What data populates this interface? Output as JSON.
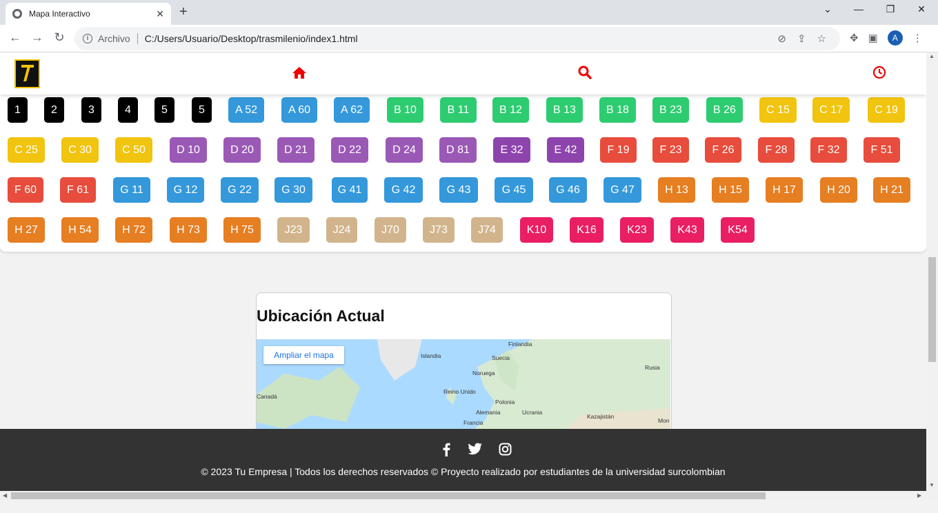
{
  "browser": {
    "tab_title": "Mapa Interactivo",
    "new_tab": "+",
    "close_tab": "✕",
    "address_prefix": "Archivo",
    "url": "C:/Users/Usuario/Desktop/trasmilenio/index1.html",
    "profile_initial": "A"
  },
  "header": {
    "home_icon": "home-icon",
    "search_icon": "search-icon",
    "history_icon": "clock-icon",
    "accent_color": "#e00000"
  },
  "colors": {
    "black": "#000000",
    "blue": "#3498db",
    "green": "#2ecc71",
    "yellow": "#f1c40f",
    "purple": "#9b59b6",
    "dark_purple": "#8e44ad",
    "red": "#e74c3c",
    "orange": "#e67e22",
    "tan": "#d2b48c",
    "pink": "#e91e63"
  },
  "routes": [
    {
      "label": "1",
      "color": "black"
    },
    {
      "label": "2",
      "color": "black"
    },
    {
      "label": "3",
      "color": "black"
    },
    {
      "label": "4",
      "color": "black"
    },
    {
      "label": "5",
      "color": "black"
    },
    {
      "label": "5",
      "color": "black"
    },
    {
      "label": "A 52",
      "color": "blue"
    },
    {
      "label": "A 60",
      "color": "blue"
    },
    {
      "label": "A 62",
      "color": "blue"
    },
    {
      "label": "B 10",
      "color": "green"
    },
    {
      "label": "B 11",
      "color": "green"
    },
    {
      "label": "B 12",
      "color": "green"
    },
    {
      "label": "B 13",
      "color": "green"
    },
    {
      "label": "B 18",
      "color": "green"
    },
    {
      "label": "B 23",
      "color": "green"
    },
    {
      "label": "B 26",
      "color": "green"
    },
    {
      "label": "C 15",
      "color": "yellow"
    },
    {
      "label": "C 17",
      "color": "yellow"
    },
    {
      "label": "C 19",
      "color": "yellow"
    },
    {
      "label": "C 25",
      "color": "yellow"
    },
    {
      "label": "C 30",
      "color": "yellow"
    },
    {
      "label": "C 50",
      "color": "yellow"
    },
    {
      "label": "D 10",
      "color": "purple"
    },
    {
      "label": "D 20",
      "color": "purple"
    },
    {
      "label": "D 21",
      "color": "purple"
    },
    {
      "label": "D 22",
      "color": "purple"
    },
    {
      "label": "D 24",
      "color": "purple"
    },
    {
      "label": "D 81",
      "color": "purple"
    },
    {
      "label": "E 32",
      "color": "dark_purple"
    },
    {
      "label": "E 42",
      "color": "dark_purple"
    },
    {
      "label": "F 19",
      "color": "red"
    },
    {
      "label": "F 23",
      "color": "red"
    },
    {
      "label": "F 26",
      "color": "red"
    },
    {
      "label": "F 28",
      "color": "red"
    },
    {
      "label": "F 32",
      "color": "red"
    },
    {
      "label": "F 51",
      "color": "red"
    },
    {
      "label": "F 60",
      "color": "red"
    },
    {
      "label": "F 61",
      "color": "red"
    },
    {
      "label": "G 11",
      "color": "blue"
    },
    {
      "label": "G 12",
      "color": "blue"
    },
    {
      "label": "G 22",
      "color": "blue"
    },
    {
      "label": "G 30",
      "color": "blue"
    },
    {
      "label": "G 41",
      "color": "blue"
    },
    {
      "label": "G 42",
      "color": "blue"
    },
    {
      "label": "G 43",
      "color": "blue"
    },
    {
      "label": "G 45",
      "color": "blue"
    },
    {
      "label": "G 46",
      "color": "blue"
    },
    {
      "label": "G 47",
      "color": "blue"
    },
    {
      "label": "H 13",
      "color": "orange"
    },
    {
      "label": "H 15",
      "color": "orange"
    },
    {
      "label": "H 17",
      "color": "orange"
    },
    {
      "label": "H 20",
      "color": "orange"
    },
    {
      "label": "H 21",
      "color": "orange"
    },
    {
      "label": "H 27",
      "color": "orange"
    },
    {
      "label": "H 54",
      "color": "orange"
    },
    {
      "label": "H 72",
      "color": "orange"
    },
    {
      "label": "H 73",
      "color": "orange"
    },
    {
      "label": "H 75",
      "color": "orange"
    },
    {
      "label": "J23",
      "color": "tan"
    },
    {
      "label": "J24",
      "color": "tan"
    },
    {
      "label": "J70",
      "color": "tan"
    },
    {
      "label": "J73",
      "color": "tan"
    },
    {
      "label": "J74",
      "color": "tan"
    },
    {
      "label": "K10",
      "color": "pink"
    },
    {
      "label": "K16",
      "color": "pink"
    },
    {
      "label": "K23",
      "color": "pink"
    },
    {
      "label": "K43",
      "color": "pink"
    },
    {
      "label": "K54",
      "color": "pink"
    }
  ],
  "map": {
    "title": "Ubicación Actual",
    "expand_label": "Ampliar el mapa",
    "places": [
      "Finlandia",
      "Islandia",
      "Suecia",
      "Rusia",
      "Noruega",
      "Reino Unido",
      "Canadá",
      "Polonia",
      "Alemania",
      "Ucrania",
      "Kazajistán",
      "Francia",
      "Mon"
    ]
  },
  "footer": {
    "copyright": "© 2023 Tu Empresa | Todos los derechos reservados © Proyecto realizado por estudiantes de la universidad surcolombian",
    "social": [
      "facebook-icon",
      "twitter-icon",
      "instagram-icon"
    ]
  }
}
